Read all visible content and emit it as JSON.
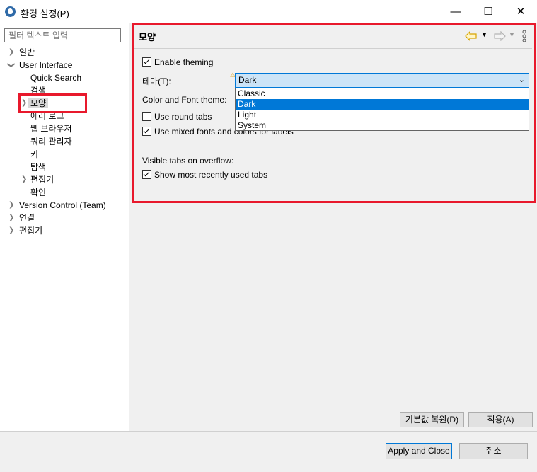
{
  "window": {
    "title": "환경 설정(P)",
    "minimize": "—",
    "maximize": "☐",
    "close": "✕"
  },
  "sidebar": {
    "filter_placeholder": "필터 텍스트 입력",
    "items": [
      {
        "label": "일반",
        "expandable": true
      },
      {
        "label": "User Interface",
        "expanded": true
      },
      {
        "label": "Quick Search"
      },
      {
        "label": "검색"
      },
      {
        "label": "모양",
        "selected": true,
        "expandable": true
      },
      {
        "label": "에러 로그"
      },
      {
        "label": "웹 브라우저"
      },
      {
        "label": "쿼리 관리자"
      },
      {
        "label": "키"
      },
      {
        "label": "탐색"
      },
      {
        "label": "편집기",
        "expandable": true
      },
      {
        "label": "확인"
      },
      {
        "label": "Version Control (Team)",
        "expandable": true
      },
      {
        "label": "연결",
        "expandable": true
      },
      {
        "label": "편집기",
        "expandable": true
      }
    ]
  },
  "main": {
    "title": "모양",
    "enable_theming": "Enable theming",
    "theme_label": "테마(T):",
    "theme_value": "Dark",
    "theme_options": [
      "Classic",
      "Dark",
      "Light",
      "System"
    ],
    "color_font_theme": "Color and Font theme:",
    "use_round_tabs": "Use round tabs",
    "use_mixed_fonts": "Use mixed fonts and colors for labels",
    "visible_tabs": "Visible tabs on overflow:",
    "show_recent_tabs": "Show most recently used tabs",
    "restore_defaults": "기본값 복원(D)",
    "apply": "적용(A)"
  },
  "footer": {
    "apply_close": "Apply and Close",
    "cancel": "취소"
  },
  "colors": {
    "highlight": "#e8192c",
    "selection": "#0078d7"
  }
}
